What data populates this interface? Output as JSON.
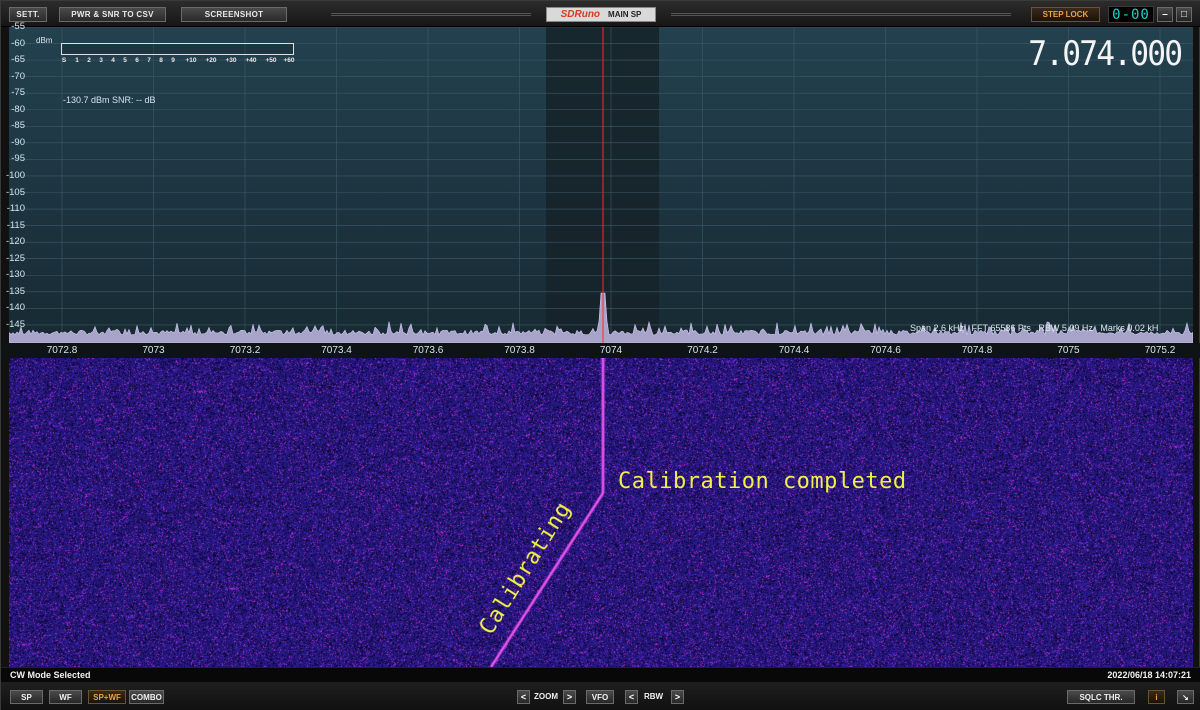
{
  "toolbar": {
    "sett_label": "SETT.",
    "pwr_snr_label": "PWR & SNR TO CSV",
    "screenshot_label": "SCREENSHOT",
    "app_logo": "SDRuno",
    "window_name": "MAIN SP",
    "step_lock_label": "STEP LOCK",
    "clock_value": "0-00",
    "minimize_label": "–",
    "maximize_label": "□",
    "close_label": "✕"
  },
  "spectrum": {
    "unit_label": "dBm",
    "y_ticks": [
      "-55",
      "-60",
      "-65",
      "-70",
      "-75",
      "-80",
      "-85",
      "-90",
      "-95",
      "-100",
      "-105",
      "-110",
      "-115",
      "-120",
      "-125",
      "-130",
      "-135",
      "-140",
      "-145"
    ],
    "x_ticks": [
      "7072.8",
      "7073",
      "7073.2",
      "7073.4",
      "7073.6",
      "7073.8",
      "7074",
      "7074.2",
      "7074.4",
      "7074.6",
      "7074.8",
      "7075",
      "7075.2"
    ],
    "s_meter_scale": [
      "S",
      "1",
      "2",
      "3",
      "4",
      "5",
      "6",
      "7",
      "8",
      "9",
      "+10",
      "+20",
      "+30",
      "+40",
      "+50",
      "+60"
    ],
    "power_readout": "-130.7 dBm  SNR: -- dB",
    "frequency_display": "7.074.000",
    "span_info": "Span 2.6 kHz   FFT 65536 Pts   RBW 5.09 Hz   Marks 0.02 kH",
    "center_frequency_khz": 7074,
    "bandwidth_khz": [
      7073.87,
      7074.12
    ],
    "signal_peak_dbm": -138
  },
  "waterfall": {
    "annotation_completed": "Calibration completed",
    "annotation_calibrating": "Calibrating"
  },
  "status": {
    "mode_text": "CW Mode Selected",
    "datetime": "2022/06/18 14:07:21"
  },
  "bottombar": {
    "sp_label": "SP",
    "wf_label": "WF",
    "spwf_label": "SP+WF",
    "combo_label": "COMBO",
    "zoom_label": "ZOOM",
    "vfo_label": "VFO",
    "rbw_label": "RBW",
    "sqlc_label": "SQLC THR.",
    "info_label": "i",
    "resize_label": "↘",
    "left_arrow": "<",
    "right_arrow": ">"
  },
  "colors": {
    "spectrum_bg": "#1c3340",
    "passband": "#1a2a30",
    "waterfall_bg": "#1b0f4a",
    "marker": "#ff2a2a",
    "accent_orange": "#f0a040",
    "annotation_yellow": "#f0f04a"
  }
}
